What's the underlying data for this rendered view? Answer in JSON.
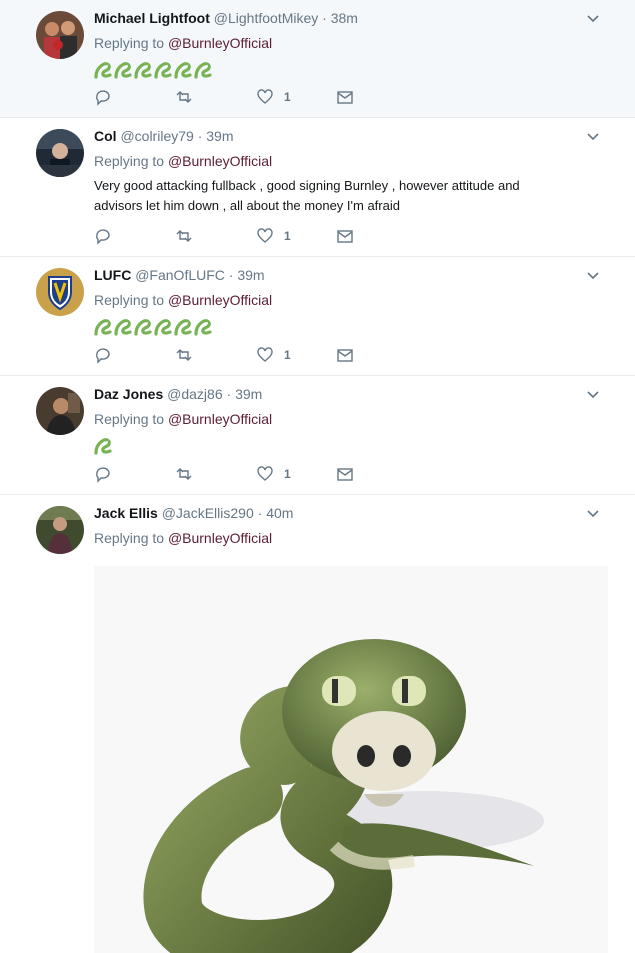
{
  "tweets": [
    {
      "name": "Michael Lightfoot",
      "handle": "@LightfootMikey",
      "time": "38m",
      "reply_prefix": "Replying to",
      "reply_to": "@BurnleyOfficial",
      "text": "",
      "snake_count": 6,
      "likes": "1",
      "avatar_icon": "boxers-photo"
    },
    {
      "name": "Col",
      "handle": "@colriley79",
      "time": "39m",
      "reply_prefix": "Replying to",
      "reply_to": "@BurnleyOfficial",
      "text": "Very good attacking fullback , good signing Burnley , however attitude and advisors let him down , all about the money I'm afraid",
      "snake_count": 0,
      "likes": "1",
      "avatar_icon": "person-photo"
    },
    {
      "name": "LUFC",
      "handle": "@FanOfLUFC",
      "time": "39m",
      "reply_prefix": "Replying to",
      "reply_to": "@BurnleyOfficial",
      "text": "",
      "snake_count": 6,
      "likes": "1",
      "avatar_icon": "leeds-crest"
    },
    {
      "name": "Daz Jones",
      "handle": "@dazj86",
      "time": "39m",
      "reply_prefix": "Replying to",
      "reply_to": "@BurnleyOfficial",
      "text": "",
      "snake_count": 1,
      "likes": "1",
      "avatar_icon": "person-photo"
    },
    {
      "name": "Jack Ellis",
      "handle": "@JackEllis290",
      "time": "40m",
      "reply_prefix": "Replying to",
      "reply_to": "@BurnleyOfficial",
      "text": "",
      "snake_count": 0,
      "likes": "",
      "avatar_icon": "person-photo",
      "media": "snake-gif"
    }
  ],
  "colors": {
    "mention": "#5c1d35",
    "muted": "#657786",
    "highlight_bg": "#f5f8fa",
    "snake_green": "#77b255"
  }
}
